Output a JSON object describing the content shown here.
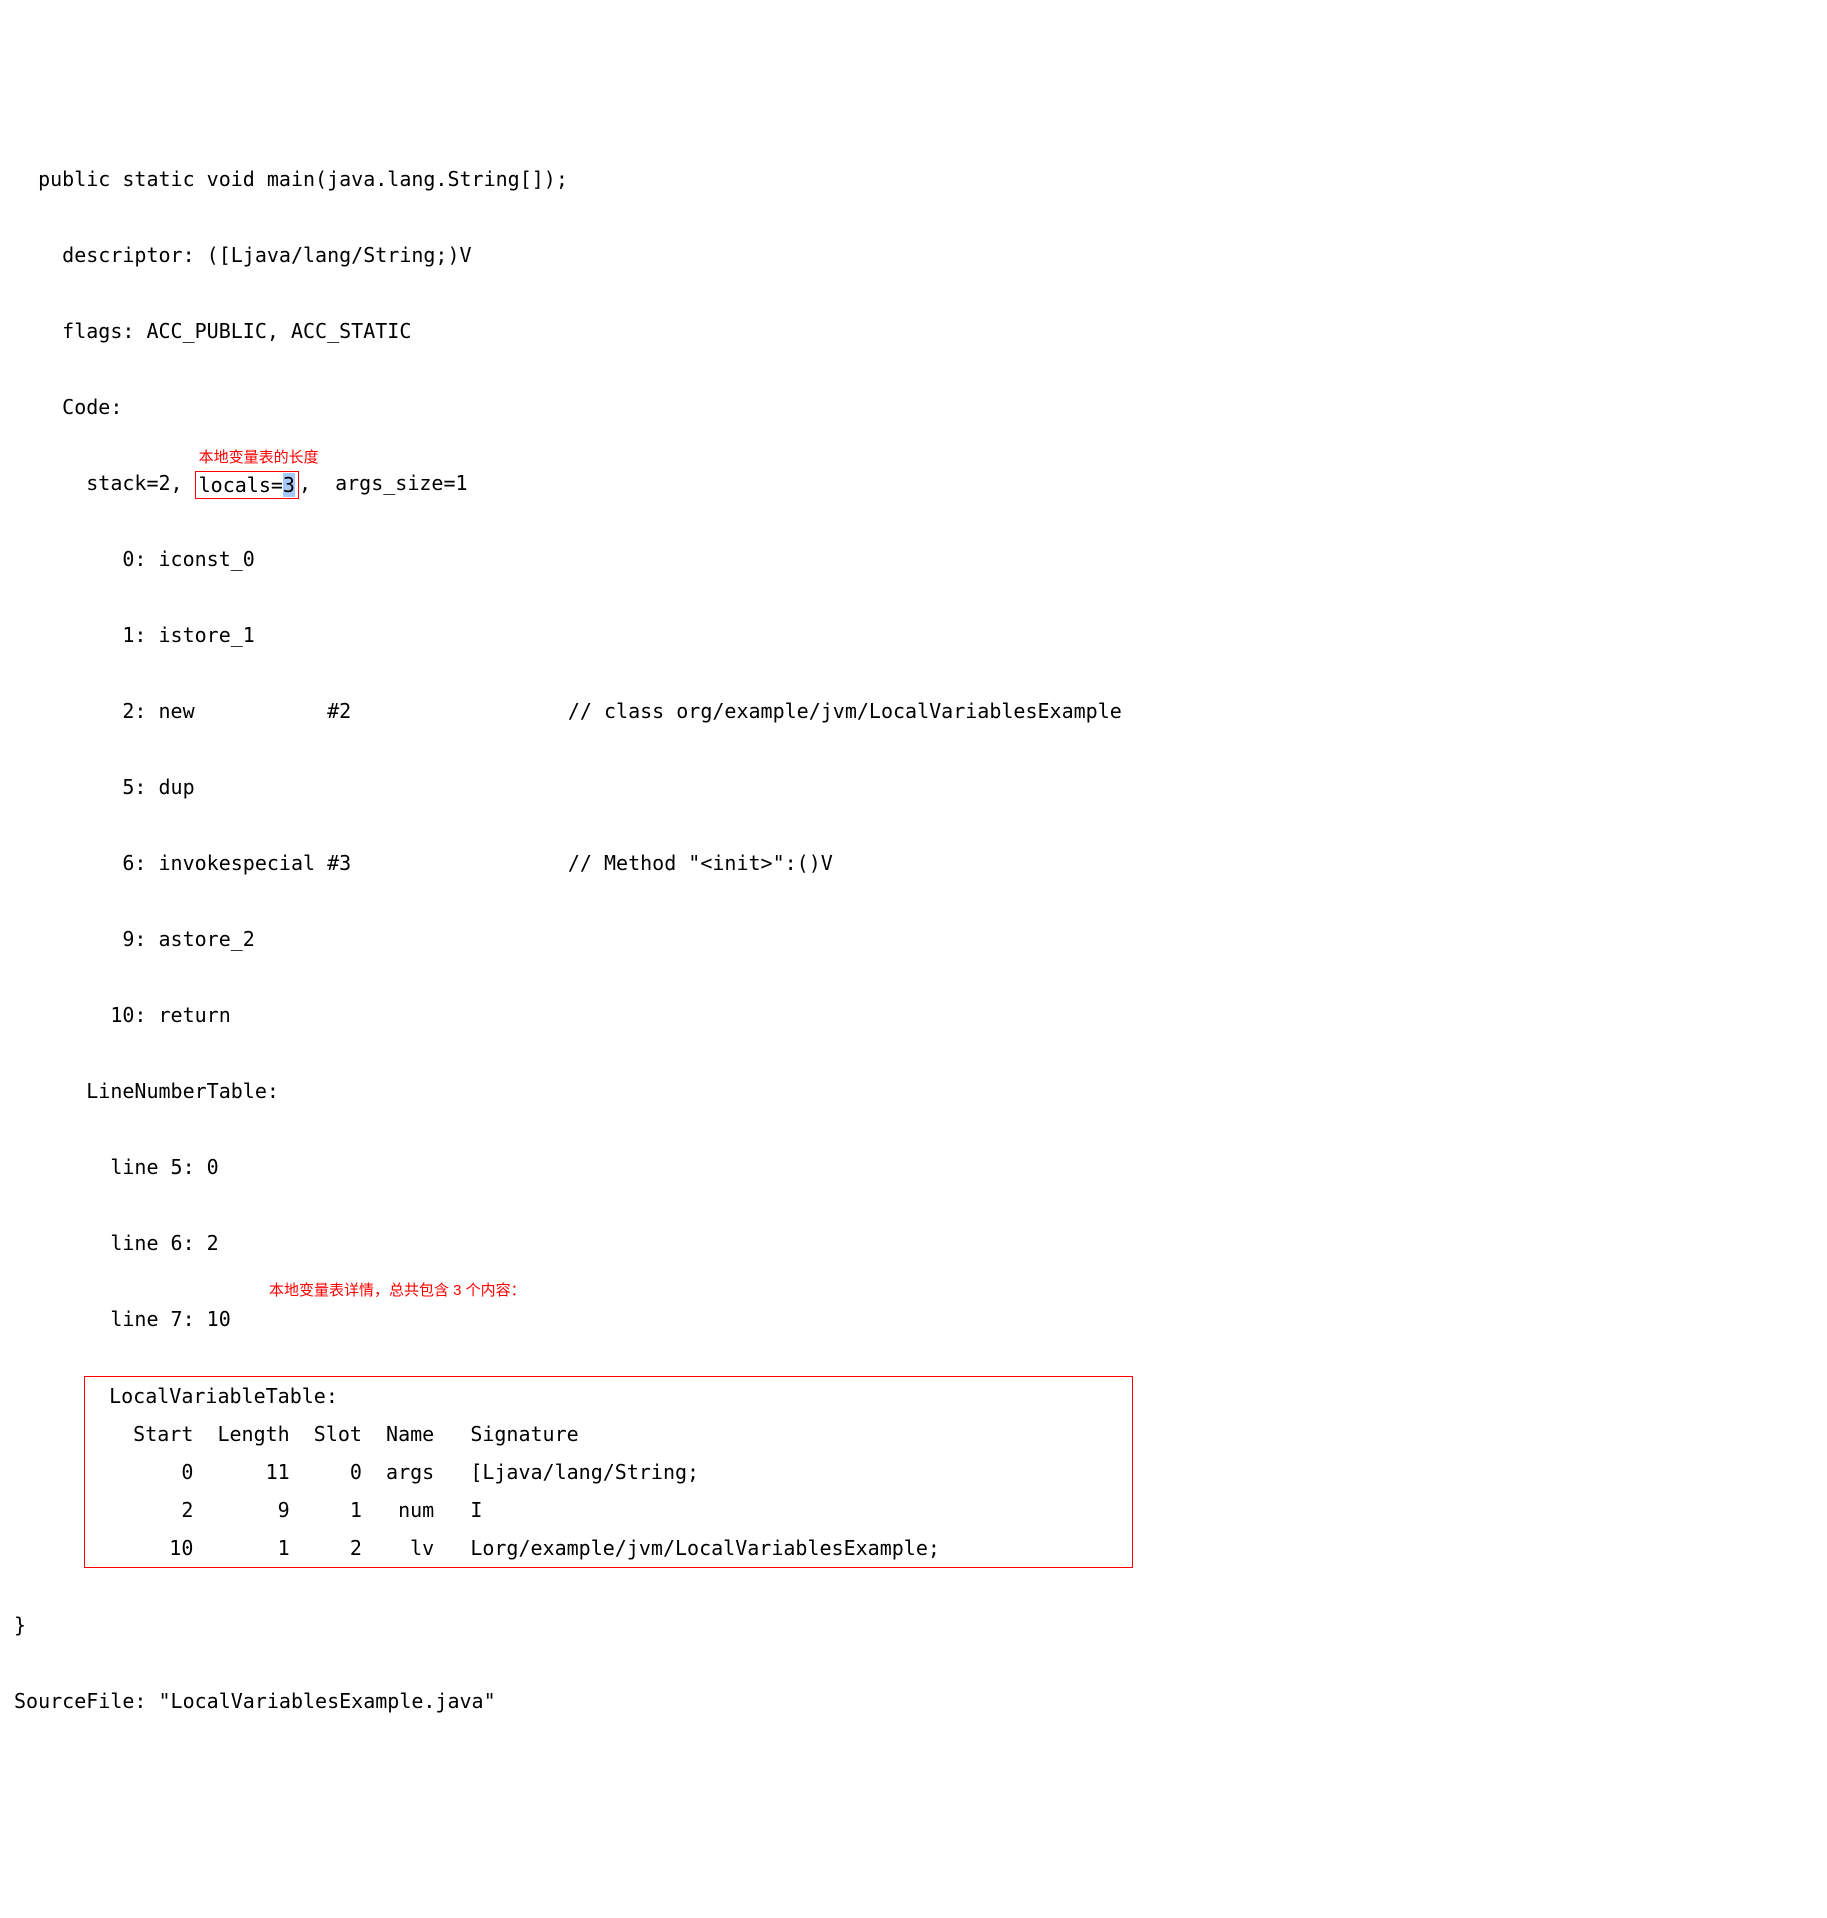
{
  "method_sig": "  public static void main(java.lang.String[]);",
  "descriptor": "    descriptor: ([Ljava/lang/String;)V",
  "flags": "    flags: ACC_PUBLIC, ACC_STATIC",
  "code_label": "    Code:",
  "annotation_locals": "本地变量表的长度",
  "stack_pre": "      stack=2, ",
  "locals_text_a": "locals=",
  "locals_text_b": "3",
  "stack_post": ",  args_size=1",
  "bytecode": [
    "         0: iconst_0",
    "         1: istore_1",
    "         2: new           #2                  // class org/example/jvm/LocalVariablesExample",
    "         5: dup",
    "         6: invokespecial #3                  // Method \"<init>\":()V",
    "         9: astore_2",
    "        10: return"
  ],
  "lnt_label": "      LineNumberTable:",
  "lnt": [
    "        line 5: 0",
    "        line 6: 2"
  ],
  "lnt_last": "        line 7: 10",
  "annotation_lvt": "本地变量表详情，总共包含 3 个内容：",
  "lvt_label": "  LocalVariableTable:",
  "lvt_header": "    Start  Length  Slot  Name   Signature",
  "lvt_rows": [
    "        0      11     0  args   [Ljava/lang/String;",
    "        2       9     1   num   I",
    "       10       1     2    lv   Lorg/example/jvm/LocalVariablesExample;"
  ],
  "closebrace": "}",
  "sourcefile": "SourceFile: \"LocalVariablesExample.java\""
}
